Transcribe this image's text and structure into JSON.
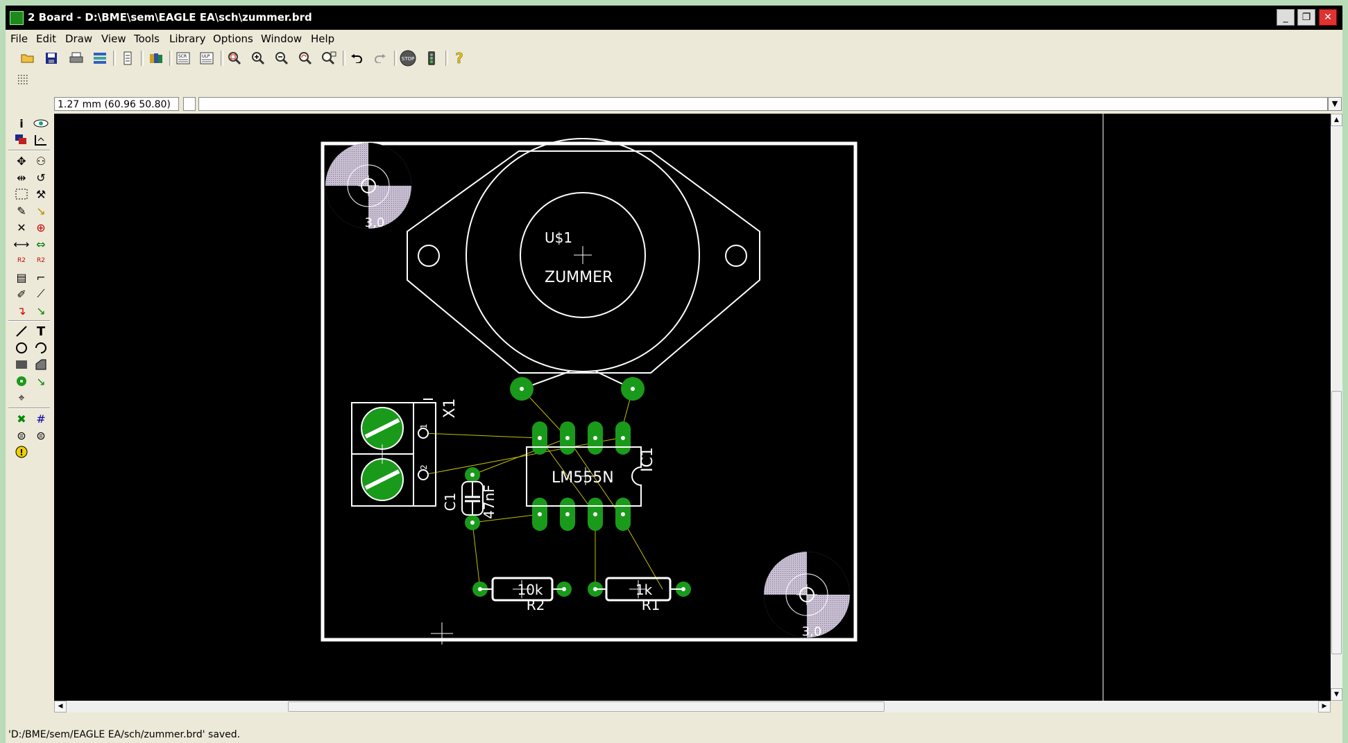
{
  "window": {
    "title": "2 Board - D:\\BME\\sem\\EAGLE EA\\sch\\zummer.brd",
    "minimize": "_",
    "restore": "❐",
    "close": "✕"
  },
  "menu": [
    "File",
    "Edit",
    "Draw",
    "View",
    "Tools",
    "Library",
    "Options",
    "Window",
    "Help"
  ],
  "toolbar": {
    "icons": [
      "open-icon",
      "save-icon",
      "print-icon",
      "cam-icon",
      "run-script-icon",
      "library-icon",
      "script-icon",
      "ulp-icon",
      "zoom-fit-icon",
      "zoom-in-icon",
      "zoom-out-icon",
      "zoom-redraw-icon",
      "zoom-select-icon",
      "undo-icon",
      "redo-icon",
      "stop-icon",
      "go-icon",
      "help-icon"
    ],
    "help_glyph": "?",
    "stop_label": "STOP"
  },
  "command_bar": {
    "coordinates": "1.27 mm (60.96 50.80)",
    "command_value": ""
  },
  "left_tools": [
    "info-icon",
    "show-icon",
    "display-layers-icon",
    "mark-icon",
    "move-icon",
    "copy-icon",
    "mirror-icon",
    "rotate-icon",
    "group-icon",
    "change-icon",
    "paste-icon",
    "delete-icon",
    "add-icon",
    "cut-icon",
    "split-icon",
    "optimize-icon",
    "name-icon",
    "value-icon",
    "smash-icon",
    "miter-icon",
    "route-icon",
    "ripup-icon",
    "wire-icon",
    "text-icon",
    "circle-icon",
    "arc-icon",
    "rect-icon",
    "polygon-icon",
    "via-icon",
    "signal-icon",
    "hole-icon",
    "ratsnest-icon",
    "auto-icon",
    "erc-icon",
    "drc-icon",
    "errors-icon"
  ],
  "board": {
    "components": [
      {
        "name": "U$1",
        "value": "ZUMMER"
      },
      {
        "name": "IC1",
        "value": "LM555N"
      },
      {
        "name": "X1",
        "pins": [
          "1",
          "2"
        ]
      },
      {
        "name": "C1",
        "value": "47nF"
      },
      {
        "name": "R2",
        "value": "10k"
      },
      {
        "name": "R1",
        "value": "1k"
      }
    ],
    "hole_label": "3,0"
  },
  "status": {
    "message": "'D:/BME/sem/EAGLE EA/sch/zummer.brd' saved."
  }
}
